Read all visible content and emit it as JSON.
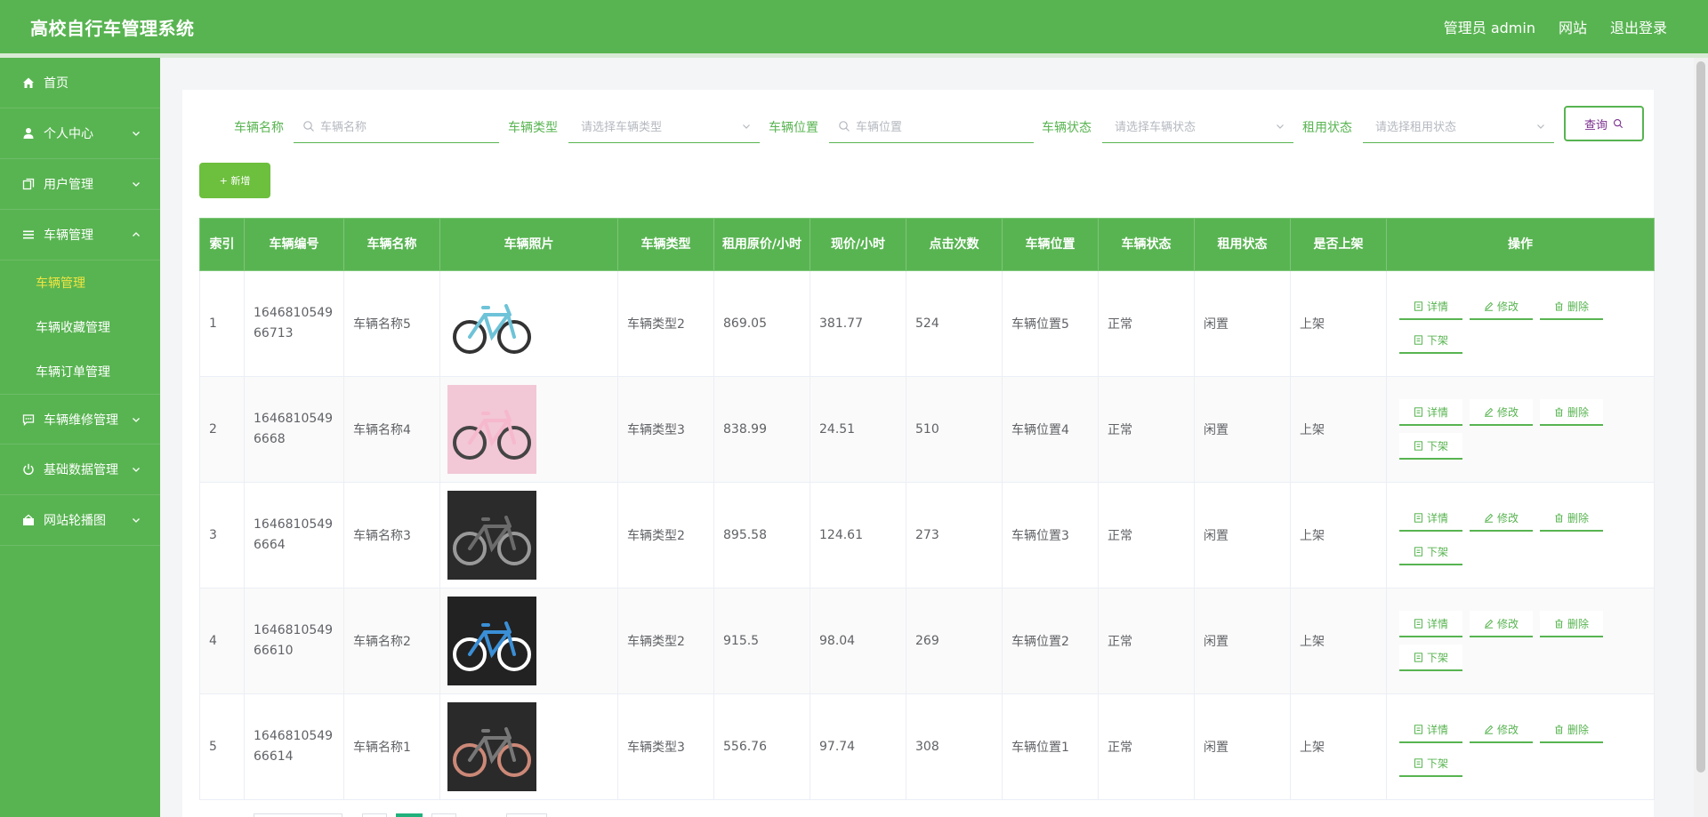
{
  "header": {
    "title": "高校自行车管理系统",
    "admin": "管理员 admin",
    "site": "网站",
    "logout": "退出登录"
  },
  "sidebar": {
    "items": [
      {
        "label": "首页",
        "icon": "home-icon"
      },
      {
        "label": "个人中心",
        "icon": "user-icon"
      },
      {
        "label": "用户管理",
        "icon": "copy-icon"
      },
      {
        "label": "车辆管理",
        "icon": "list-icon"
      },
      {
        "label": "车辆维修管理",
        "icon": "chat-icon"
      },
      {
        "label": "基础数据管理",
        "icon": "power-icon"
      },
      {
        "label": "网站轮播图",
        "icon": "image-icon"
      }
    ],
    "sub_items": [
      "车辆管理",
      "车辆收藏管理",
      "车辆订单管理"
    ]
  },
  "filters": {
    "name_label": "车辆名称",
    "name_placeholder": "车辆名称",
    "type_label": "车辆类型",
    "type_placeholder": "请选择车辆类型",
    "location_label": "车辆位置",
    "location_placeholder": "车辆位置",
    "status_label": "车辆状态",
    "status_placeholder": "请选择车辆状态",
    "rent_label": "租用状态",
    "rent_placeholder": "请选择租用状态",
    "query": "查询"
  },
  "add_button": "+ 新增",
  "table": {
    "headers": [
      "索引",
      "车辆编号",
      "车辆名称",
      "车辆照片",
      "车辆类型",
      "租用原价/小时",
      "现价/小时",
      "点击次数",
      "车辆位置",
      "车辆状态",
      "租用状态",
      "是否上架",
      "操作"
    ],
    "rows": [
      {
        "index": "1",
        "code": "164681054966713",
        "name": "车辆名称5",
        "type": "车辆类型2",
        "orig": "869.05",
        "price": "381.77",
        "clicks": "524",
        "location": "车辆位置5",
        "status": "正常",
        "rent": "闲置",
        "shelf": "上架"
      },
      {
        "index": "2",
        "code": "16468105496668",
        "name": "车辆名称4",
        "type": "车辆类型3",
        "orig": "838.99",
        "price": "24.51",
        "clicks": "510",
        "location": "车辆位置4",
        "status": "正常",
        "rent": "闲置",
        "shelf": "上架"
      },
      {
        "index": "3",
        "code": "16468105496664",
        "name": "车辆名称3",
        "type": "车辆类型2",
        "orig": "895.58",
        "price": "124.61",
        "clicks": "273",
        "location": "车辆位置3",
        "status": "正常",
        "rent": "闲置",
        "shelf": "上架"
      },
      {
        "index": "4",
        "code": "164681054966610",
        "name": "车辆名称2",
        "type": "车辆类型2",
        "orig": "915.5",
        "price": "98.04",
        "clicks": "269",
        "location": "车辆位置2",
        "status": "正常",
        "rent": "闲置",
        "shelf": "上架"
      },
      {
        "index": "5",
        "code": "164681054966614",
        "name": "车辆名称1",
        "type": "车辆类型3",
        "orig": "556.76",
        "price": "97.74",
        "clicks": "308",
        "location": "车辆位置1",
        "status": "正常",
        "rent": "闲置",
        "shelf": "上架"
      }
    ],
    "actions": {
      "detail": "详情",
      "edit": "修改",
      "delete": "删除",
      "offshelf": "下架"
    }
  },
  "colors": {
    "brand": "#58b451",
    "active_sub": "#f0e442",
    "query_text": "#7a2f8d"
  }
}
